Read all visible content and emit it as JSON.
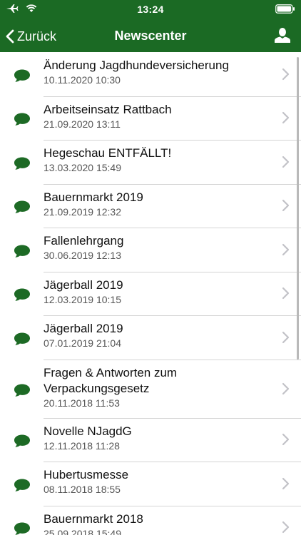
{
  "status_bar": {
    "time": "13:24"
  },
  "nav": {
    "back_label": "Zurück",
    "title": "Newscenter"
  },
  "colors": {
    "brand_green": "#1b6a24",
    "icon_green": "#1d6a25",
    "chevron": "#c2c2c7",
    "separator": "#d4d4d4"
  },
  "icons": {
    "back": "chevron-left-icon",
    "profile": "person-icon",
    "item": "speech-bubble-icon",
    "disclosure": "chevron-right-icon"
  },
  "news": [
    {
      "title": "Änderung Jagdhundeversicherung",
      "date": "10.11.2020 10:30"
    },
    {
      "title": "Arbeitseinsatz Rattbach",
      "date": "21.09.2020 13:11"
    },
    {
      "title": "Hegeschau ENTFÄLLT!",
      "date": "13.03.2020 15:49"
    },
    {
      "title": "Bauernmarkt 2019",
      "date": "21.09.2019 12:32"
    },
    {
      "title": "Fallenlehrgang",
      "date": "30.06.2019 12:13"
    },
    {
      "title": "Jägerball 2019",
      "date": "12.03.2019 10:15"
    },
    {
      "title": "Jägerball 2019",
      "date": "07.01.2019 21:04"
    },
    {
      "title": "Fragen & Antworten zum Verpackungsgesetz",
      "date": "20.11.2018 11:53"
    },
    {
      "title": "Novelle NJagdG",
      "date": "12.11.2018 11:28"
    },
    {
      "title": "Hubertusmesse",
      "date": "08.11.2018 18:55"
    },
    {
      "title": "Bauernmarkt 2018",
      "date": "25.09.2018 15:49"
    }
  ]
}
